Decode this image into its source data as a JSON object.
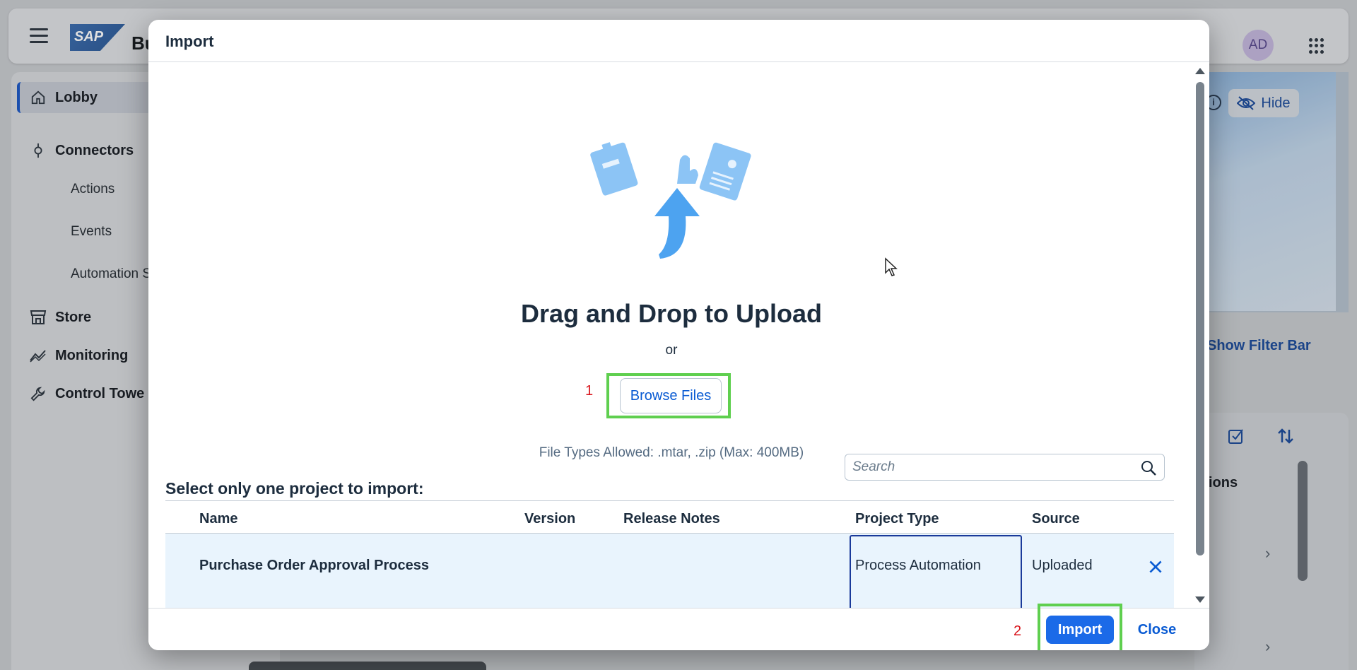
{
  "app": {
    "title": "Bu",
    "avatar_initials": "AD",
    "hide_label": "Hide",
    "show_filter_label": "Show Filter Bar",
    "columns_partial": "ions",
    "logo_text": "SAP"
  },
  "sidenav": {
    "items": [
      {
        "label": "Lobby",
        "icon": "home-icon",
        "active": true
      },
      {
        "label": "Connectors",
        "icon": "connector-icon"
      },
      {
        "label": "Actions",
        "sub": true
      },
      {
        "label": "Events",
        "sub": true
      },
      {
        "label": "Automation S",
        "sub": true
      },
      {
        "label": "Store",
        "icon": "store-icon"
      },
      {
        "label": "Monitoring",
        "icon": "monitoring-icon"
      },
      {
        "label": "Control Towe",
        "icon": "wrench-icon"
      }
    ]
  },
  "dialog": {
    "title": "Import",
    "drag_drop_title": "Drag and Drop to Upload",
    "or_text": "or",
    "browse_label": "Browse Files",
    "file_types_text": "File Types Allowed: .mtar, .zip  (Max: 400MB)",
    "select_label": "Select only one project to import:",
    "search_placeholder": "Search",
    "annotation_1": "1",
    "annotation_2": "2",
    "table": {
      "headers": [
        "Name",
        "Version",
        "Release Notes",
        "Project Type",
        "Source"
      ],
      "rows": [
        {
          "name": "Purchase Order Approval Process",
          "version": "",
          "release_notes": "",
          "project_type": "Process Automation",
          "source": "Uploaded"
        }
      ]
    },
    "import_label": "Import",
    "close_label": "Close"
  },
  "colors": {
    "accent": "#0a5bd3",
    "primary_button": "#1b6ae8",
    "highlight_box": "#5fcf4f",
    "annotation": "#d9141b",
    "selected_row": "#e9f4fd"
  }
}
